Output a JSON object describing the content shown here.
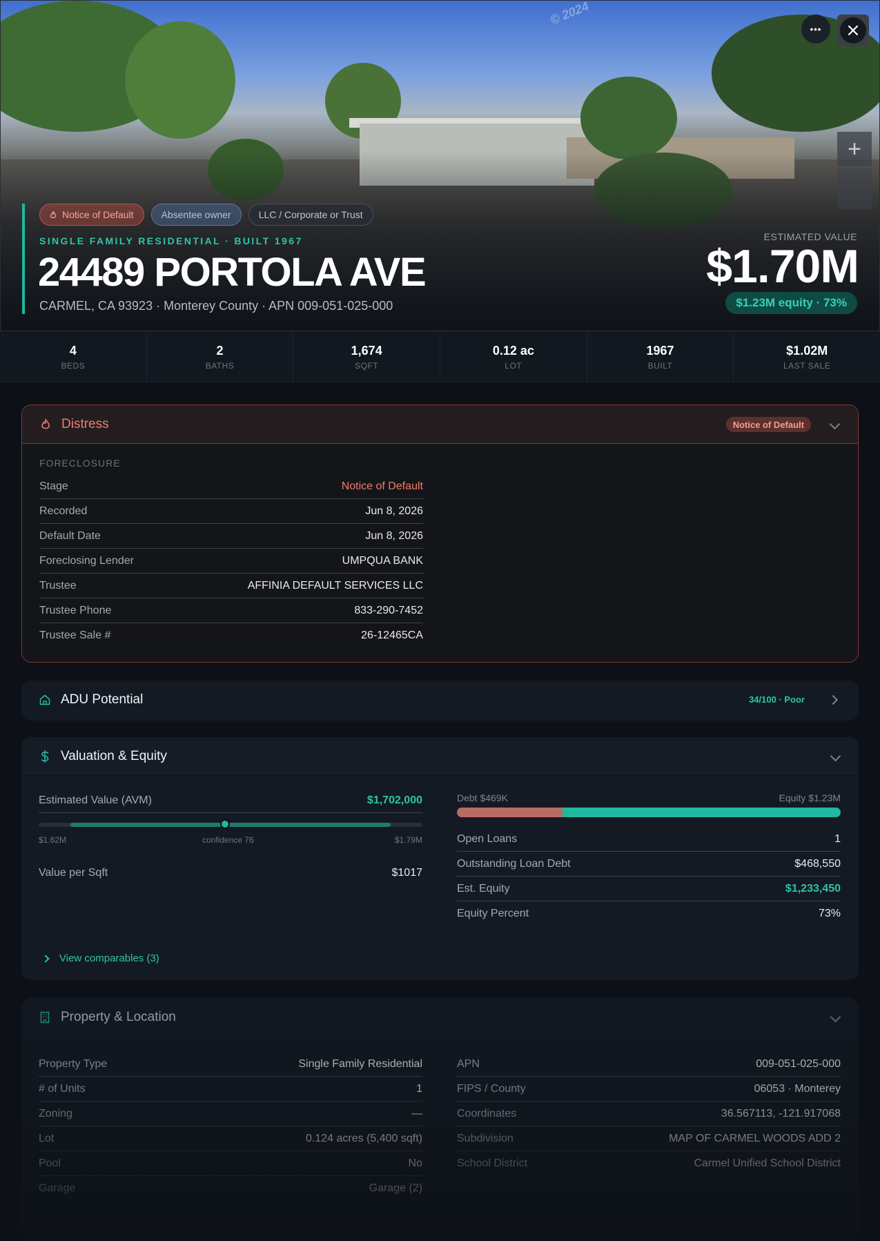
{
  "hero": {
    "watermark": "© 2024",
    "tags": [
      "Notice of Default",
      "Absentee owner",
      "LLC / Corporate or Trust"
    ],
    "subtype": "SINGLE FAMILY RESIDENTIAL · BUILT 1967",
    "address": "24489 PORTOLA AVE",
    "location": "CARMEL, CA 93923 · Monterey County · APN 009-051-025-000",
    "est_label": "ESTIMATED VALUE",
    "est_value": "$1.70M",
    "equity": "$1.23M equity · 73%",
    "more_glyph": "•••",
    "zoom_glyph": "+"
  },
  "stats": [
    {
      "value": "4",
      "label": "BEDS"
    },
    {
      "value": "2",
      "label": "BATHS"
    },
    {
      "value": "1,674",
      "label": "SQFT"
    },
    {
      "value": "0.12 ac",
      "label": "LOT"
    },
    {
      "value": "1967",
      "label": "BUILT"
    },
    {
      "value": "$1.02M",
      "label": "LAST SALE"
    }
  ],
  "distress": {
    "title": "Distress",
    "badge": "Notice of Default",
    "section": "FORECLOSURE",
    "rows": [
      {
        "k": "Stage",
        "v": "Notice of Default"
      },
      {
        "k": "Recorded",
        "v": "Jun 8, 2026"
      },
      {
        "k": "Default Date",
        "v": "Jun 8, 2026"
      },
      {
        "k": "Foreclosing Lender",
        "v": "UMPQUA BANK"
      },
      {
        "k": "Trustee",
        "v": "AFFINIA DEFAULT SERVICES LLC"
      },
      {
        "k": "Trustee Phone",
        "v": "833-290-7452"
      },
      {
        "k": "Trustee Sale #",
        "v": "26-12465CA"
      }
    ]
  },
  "adu": {
    "title": "ADU Potential",
    "score": "34/100 · Poor"
  },
  "valuation": {
    "title": "Valuation & Equity",
    "avm_label": "Estimated Value (AVM)",
    "avm_value": "$1,702,000",
    "range_low": "$1.62M",
    "range_high": "$1.79M",
    "confidence": "confidence 76",
    "range_min": 1.62,
    "range_max": 1.79,
    "range_point": 1.702,
    "vps_label": "Value per Sqft",
    "vps_value": "$1017",
    "debt_label": "Debt $469K",
    "equity_label": "Equity $1.23M",
    "debt_fraction": 0.276,
    "rows": [
      {
        "k": "Open Loans",
        "v": "1"
      },
      {
        "k": "Outstanding Loan Debt",
        "v": "$468,550"
      },
      {
        "k": "Est. Equity",
        "v": "$1,233,450"
      },
      {
        "k": "Equity Percent",
        "v": "73%"
      }
    ],
    "view_comps": "View comparables (3)"
  },
  "property": {
    "title": "Property & Location",
    "left": [
      {
        "k": "Property Type",
        "v": "Single Family Residential"
      },
      {
        "k": "# of Units",
        "v": "1"
      },
      {
        "k": "Zoning",
        "v": "—"
      },
      {
        "k": "Lot",
        "v": "0.124 acres (5,400 sqft)"
      },
      {
        "k": "Pool",
        "v": "No"
      },
      {
        "k": "Garage",
        "v": "Garage (2)"
      }
    ],
    "right": [
      {
        "k": "APN",
        "v": "009-051-025-000"
      },
      {
        "k": "FIPS / County",
        "v": "06053 · Monterey"
      },
      {
        "k": "Coordinates",
        "v": "36.567113, -121.917068"
      },
      {
        "k": "Subdivision",
        "v": "MAP OF CARMEL WOODS ADD 2"
      },
      {
        "k": "School District",
        "v": "Carmel Unified School District"
      }
    ]
  },
  "colors": {
    "accent": "#1fb8a0",
    "danger": "#ef7d6c",
    "background": "#0d1117",
    "card": "#131a23"
  }
}
